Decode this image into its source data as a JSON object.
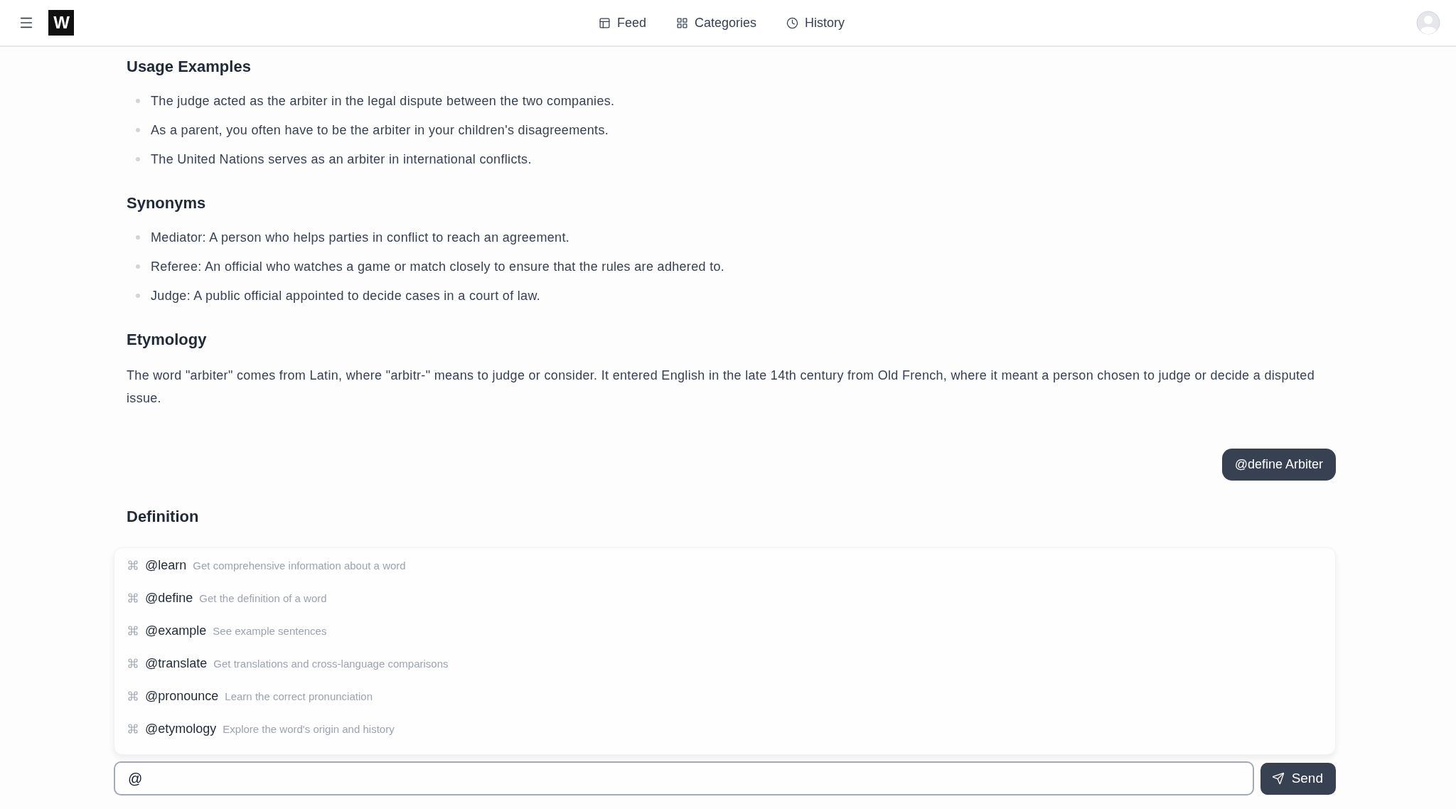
{
  "header": {
    "logo": "W",
    "nav": [
      {
        "kind": "feed",
        "label": "Feed"
      },
      {
        "kind": "categories",
        "label": "Categories"
      },
      {
        "kind": "history",
        "label": "History"
      }
    ]
  },
  "sections": [
    {
      "kind": "list",
      "heading": "Usage Examples",
      "items": [
        "The judge acted as the arbiter in the legal dispute between the two companies.",
        "As a parent, you often have to be the arbiter in your children's disagreements.",
        "The United Nations serves as an arbiter in international conflicts."
      ]
    },
    {
      "kind": "list",
      "heading": "Synonyms",
      "items": [
        "Mediator: A person who helps parties in conflict to reach an agreement.",
        "Referee: An official who watches a game or match closely to ensure that the rules are adhered to.",
        "Judge: A public official appointed to decide cases in a court of law."
      ]
    },
    {
      "kind": "paragraph",
      "heading": "Etymology",
      "text": "The word \"arbiter\" comes from Latin, where \"arbitr-\" means to judge or consider. It entered English in the late 14th century from Old French, where it meant a person chosen to judge or decide a disputed issue."
    }
  ],
  "user_message": "@define Arbiter",
  "reply_heading": "Definition",
  "command_menu": [
    {
      "command": "@learn",
      "description": "Get comprehensive information about a word"
    },
    {
      "command": "@define",
      "description": "Get the definition of a word"
    },
    {
      "command": "@example",
      "description": "See example sentences"
    },
    {
      "command": "@translate",
      "description": "Get translations and cross-language comparisons"
    },
    {
      "command": "@pronounce",
      "description": "Learn the correct pronunciation"
    },
    {
      "command": "@etymology",
      "description": "Explore the word's origin and history"
    }
  ],
  "composer": {
    "value": "@",
    "button": "Send"
  }
}
